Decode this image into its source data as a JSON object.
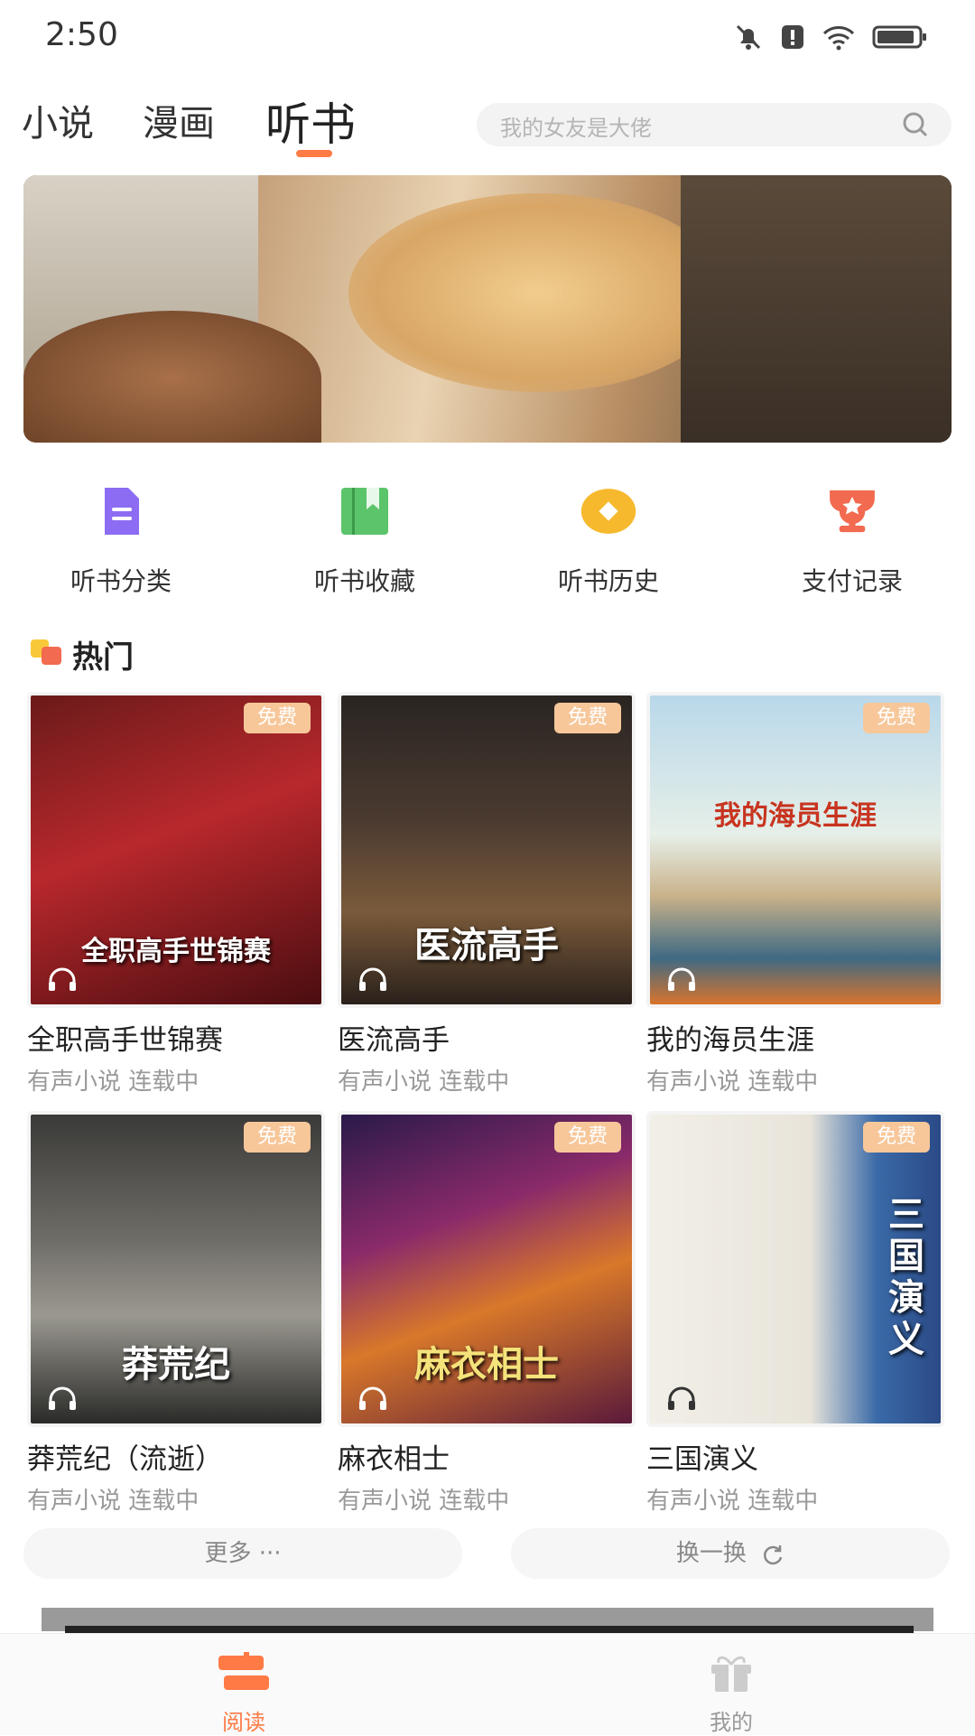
{
  "status_bar": {
    "time": "2:50"
  },
  "tabs": [
    {
      "label": "小说",
      "active": false
    },
    {
      "label": "漫画",
      "active": false
    },
    {
      "label": "听书",
      "active": true
    }
  ],
  "search": {
    "placeholder": "我的女友是大佬"
  },
  "quick_entries": [
    {
      "label": "听书分类",
      "icon": "document-icon",
      "color": "#8c6cf2"
    },
    {
      "label": "听书收藏",
      "icon": "bookmark-book-icon",
      "color": "#5cc46a"
    },
    {
      "label": "听书历史",
      "icon": "diamond-coin-icon",
      "color": "#f6b92d"
    },
    {
      "label": "支付记录",
      "icon": "trophy-icon",
      "color": "#f26a4f"
    }
  ],
  "section": {
    "title": "热门"
  },
  "books": [
    {
      "name": "全职高手世锦赛",
      "sub": "有声小说 连载中",
      "badge": "免费",
      "cover_text": "全职高手世锦赛"
    },
    {
      "name": "医流高手",
      "sub": "有声小说 连载中",
      "badge": "免费",
      "cover_text": "医流高手"
    },
    {
      "name": "我的海员生涯",
      "sub": "有声小说 连载中",
      "badge": "免费",
      "cover_text": "我的海员生涯"
    },
    {
      "name": "莽荒纪（流逝）",
      "sub": "有声小说 连载中",
      "badge": "免费",
      "cover_text": "莽荒纪"
    },
    {
      "name": "麻衣相士",
      "sub": "有声小说 连载中",
      "badge": "免费",
      "cover_text": "麻衣相士"
    },
    {
      "name": "三国演义",
      "sub": "有声小说 连载中",
      "badge": "免费",
      "cover_text": "三国演义"
    }
  ],
  "buttons": {
    "more": "更多 ···",
    "refresh": "换一换"
  },
  "bottom_nav": [
    {
      "label": "阅读",
      "icon": "book-stack-icon",
      "active": true
    },
    {
      "label": "我的",
      "icon": "gift-icon",
      "active": false
    }
  ],
  "colors": {
    "accent": "#ff7a45",
    "badge": "#f7c79a"
  }
}
